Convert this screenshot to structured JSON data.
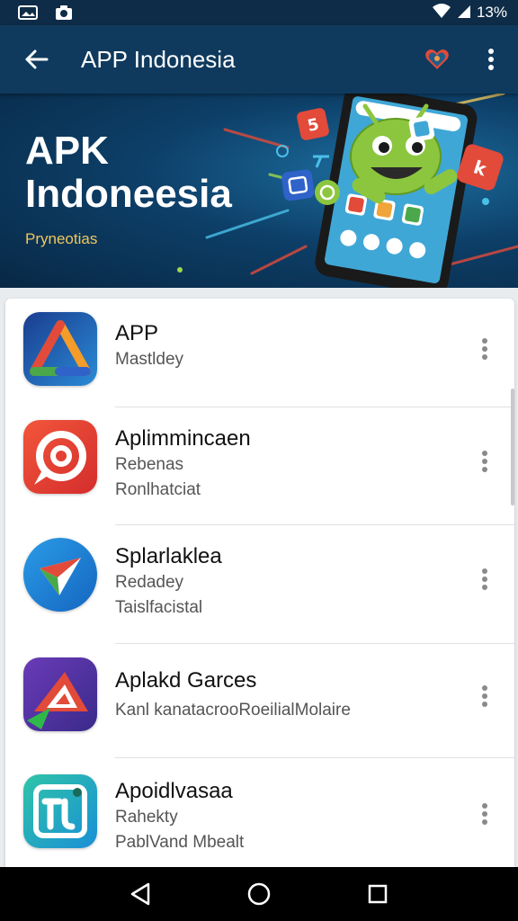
{
  "status_bar": {
    "battery_text": "13%",
    "left_icons": [
      "image-icon",
      "camera-icon"
    ],
    "right_icons": [
      "wifi-icon",
      "signal-icon"
    ]
  },
  "app_bar": {
    "title": "APP Indonesia",
    "back_icon": "back-arrow-icon",
    "action_icon": "heart-icon",
    "overflow_icon": "more-vert-icon"
  },
  "banner": {
    "title_line1": "APK",
    "title_line2": "Indoneesia",
    "subtitle": "Pryneotias"
  },
  "apps": [
    {
      "title": "APP",
      "line1": "Mastldey",
      "line2": ""
    },
    {
      "title": "Aplimmincaen",
      "line1": "Rebenas",
      "line2": "Ronlhatciat"
    },
    {
      "title": "Splarlaklea",
      "line1": "Redadey",
      "line2": "Taislfacistal"
    },
    {
      "title": "Aplakd Garces",
      "line1": "Kanl kanatacrooRoeilialMolaire",
      "line2": ""
    },
    {
      "title": "Apoidlvasaa",
      "line1": "Rahekty",
      "line2": "PablVand Mbealt"
    }
  ],
  "colors": {
    "app_bar": "#0f3a5e",
    "status_bar": "#0e2c47",
    "banner_subtitle": "#f0c75a"
  }
}
